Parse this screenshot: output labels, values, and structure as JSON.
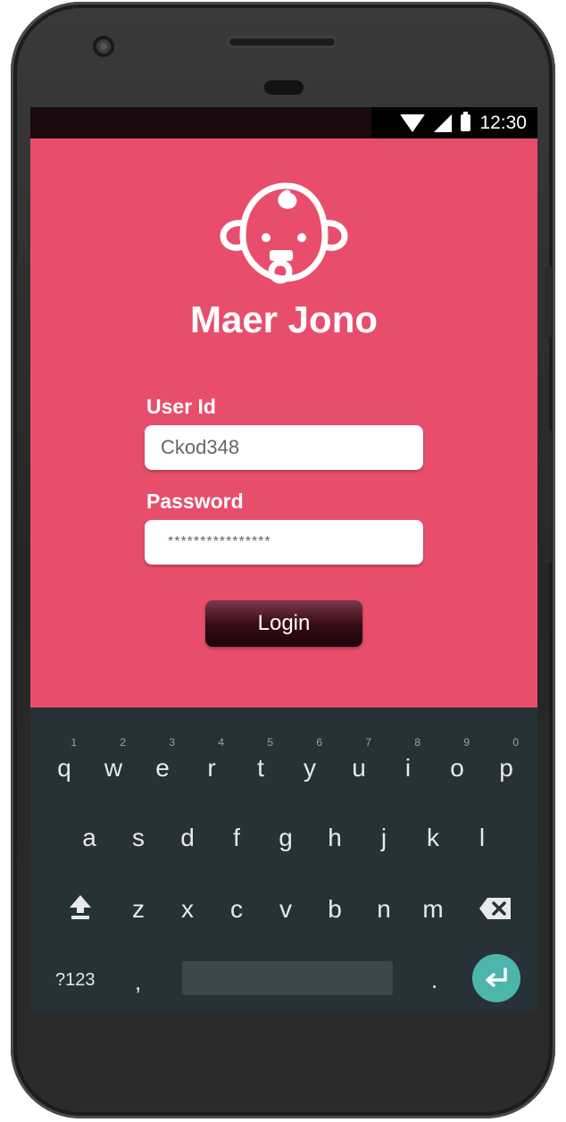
{
  "status_bar": {
    "time": "12:30",
    "icons": [
      "wifi-icon",
      "signal-icon",
      "battery-icon"
    ]
  },
  "app": {
    "title": "Maer Jono",
    "logo_icon": "baby-face-icon",
    "accent_color": "#e84e6b"
  },
  "form": {
    "user_id_label": "User Id",
    "user_id_value": "Ckod348",
    "password_label": "Password",
    "password_value": "****************",
    "login_label": "Login"
  },
  "keyboard": {
    "row1": [
      "q",
      "w",
      "e",
      "r",
      "t",
      "y",
      "u",
      "i",
      "o",
      "p"
    ],
    "hints": [
      "1",
      "2",
      "3",
      "4",
      "5",
      "6",
      "7",
      "8",
      "9",
      "0"
    ],
    "row2": [
      "a",
      "s",
      "d",
      "f",
      "g",
      "h",
      "j",
      "k",
      "l"
    ],
    "row3": [
      "z",
      "x",
      "c",
      "v",
      "b",
      "n",
      "m"
    ],
    "symbols_label": "?123",
    "comma": ",",
    "period": ".",
    "icons": [
      "shift-icon",
      "backspace-icon",
      "enter-icon"
    ]
  }
}
